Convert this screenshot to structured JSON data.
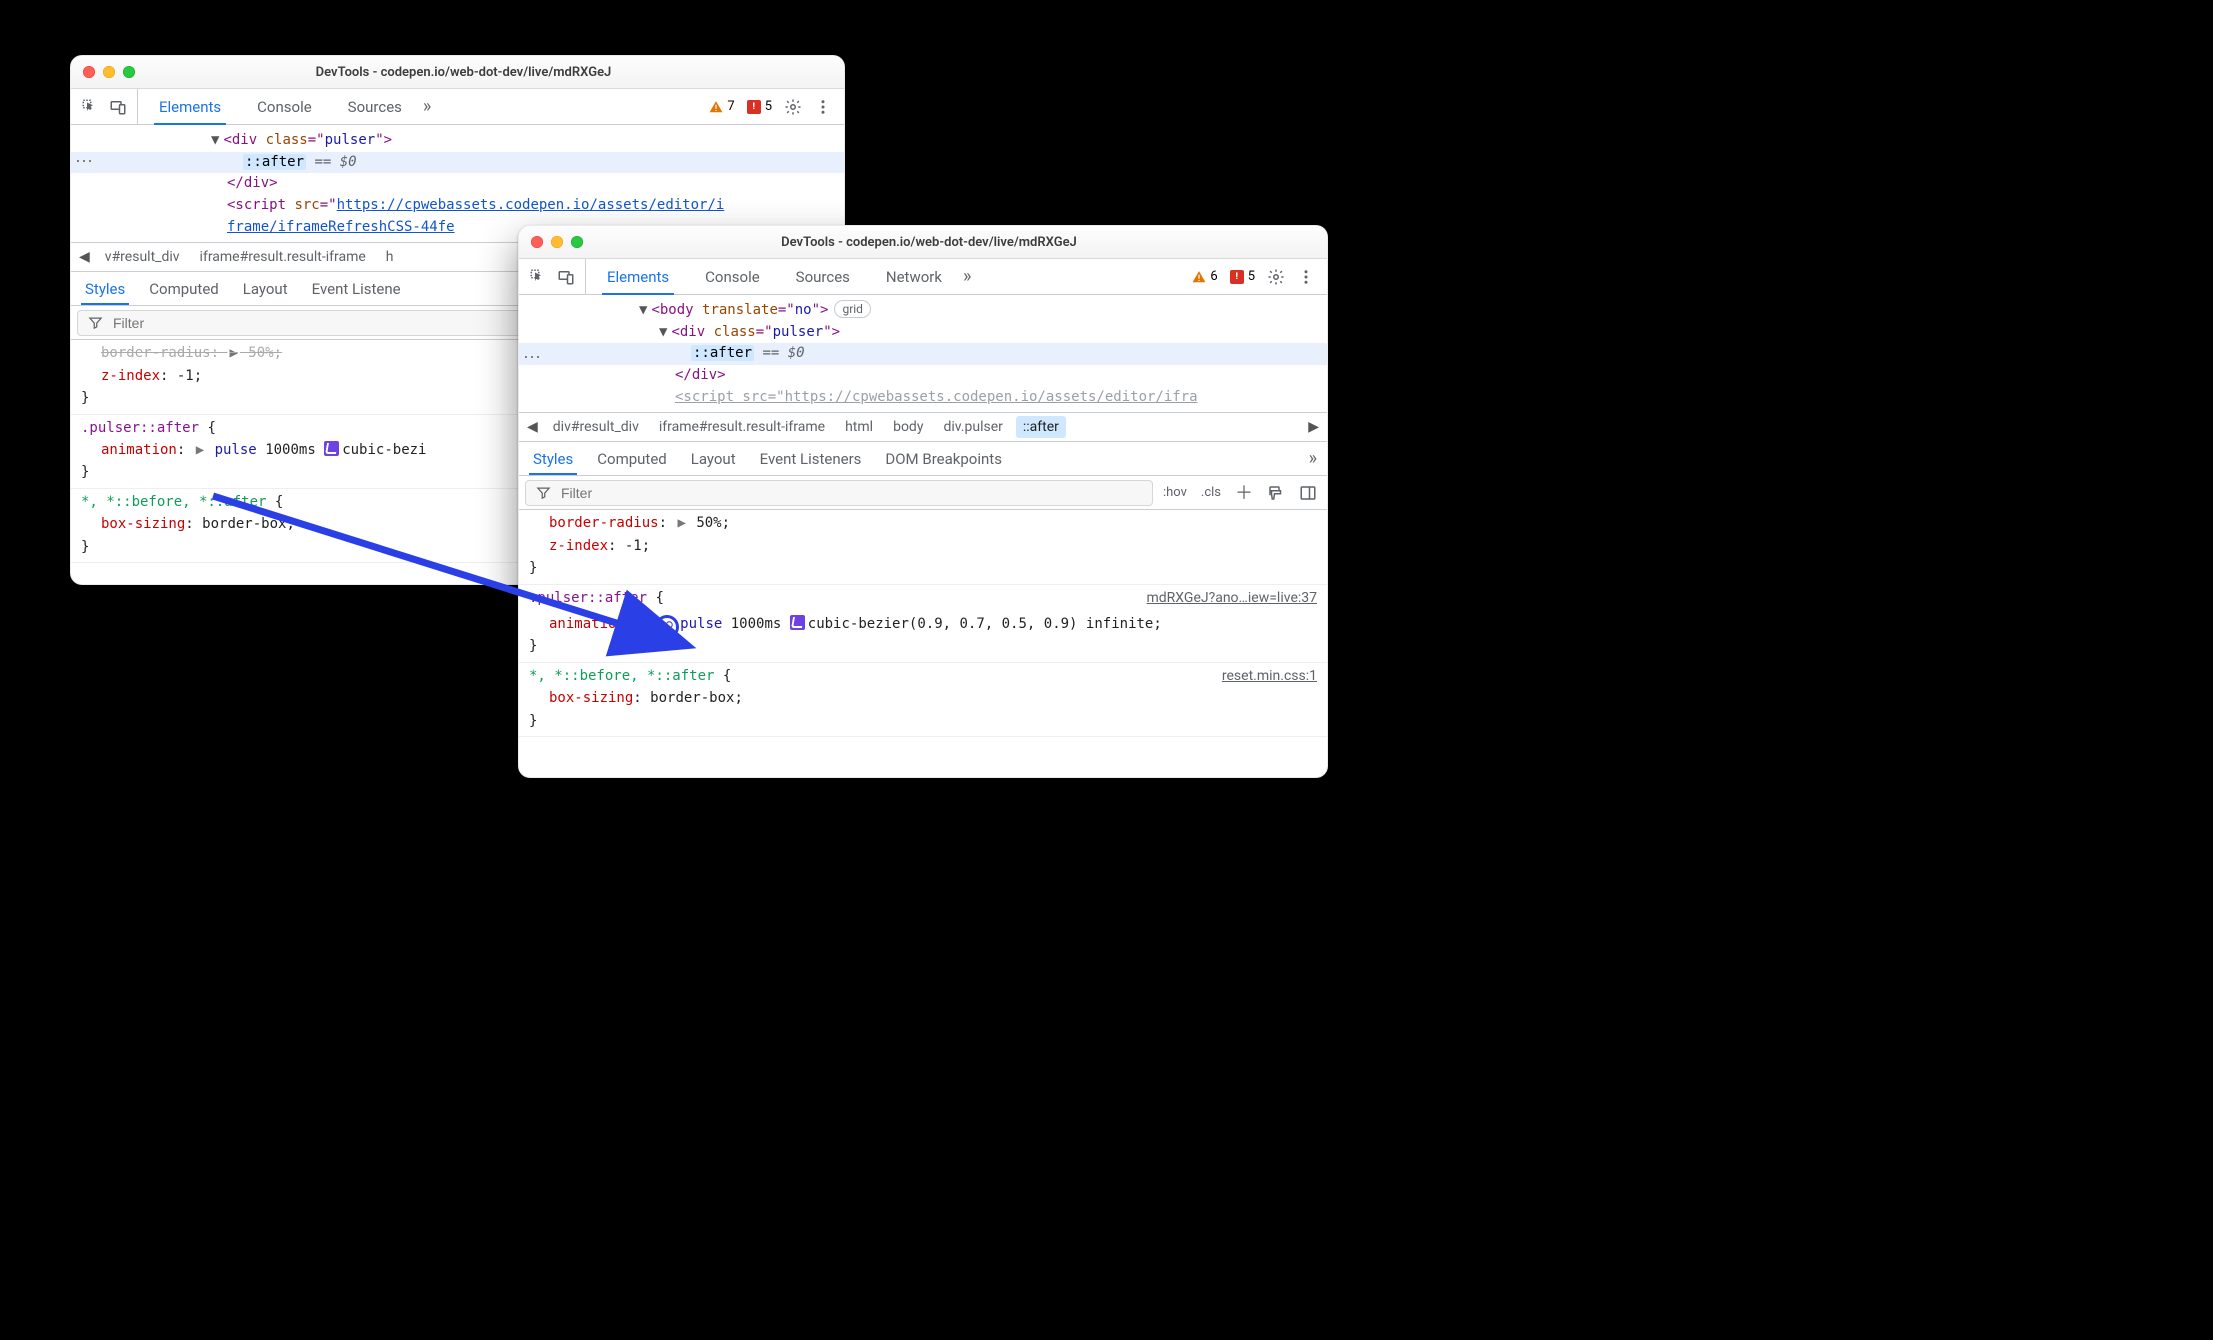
{
  "win1": {
    "title": "DevTools - codepen.io/web-dot-dev/live/mdRXGeJ",
    "tabs": {
      "elements": "Elements",
      "console": "Console",
      "sources": "Sources"
    },
    "warn_count": "7",
    "err_count": "5",
    "dom": {
      "div_open": "<div class=\"pulser\">",
      "after": "::after",
      "eq": "== $0",
      "div_close": "</div>",
      "script_open_a": "<script src=\"",
      "script_href1": "https://cpwebassets.codepen.io/assets/editor/i",
      "script_href2": "frame/iframeRefreshCSS-44fe"
    },
    "crumbs": {
      "a": "v#result_div",
      "b": "iframe#result.result-iframe",
      "c": "h"
    },
    "subtabs": {
      "styles": "Styles",
      "computed": "Computed",
      "layout": "Layout",
      "ev": "Event Listene"
    },
    "filter_placeholder": "Filter",
    "styles": {
      "fragA_prop": "border-radius",
      "fragA_tri": "▶",
      "fragA_val": "50%",
      "z_prop": "z-index",
      "z_val": "-1",
      "rule2_sel": ".pulser::after",
      "r2_prop": "animation",
      "r2_tri": "▶",
      "r2_name": "pulse",
      "r2_dur": "1000ms",
      "r2_cb": "cubic-bezi",
      "rule3_sel": "*, *::before, *::after",
      "r3_prop": "box-sizing",
      "r3_val": "border-box"
    }
  },
  "win2": {
    "title": "DevTools - codepen.io/web-dot-dev/live/mdRXGeJ",
    "tabs": {
      "elements": "Elements",
      "console": "Console",
      "sources": "Sources",
      "network": "Network"
    },
    "warn_count": "6",
    "err_count": "5",
    "dom": {
      "body_open": "<body translate=\"no\">",
      "body_badge": "grid",
      "div_open": "<div class=\"pulser\">",
      "after": "::after",
      "eq": "== $0",
      "div_close": "</div>",
      "script_cut": "<script src=\"https://cpwebassets.codepen.io/assets/editor/ifra"
    },
    "crumbs": {
      "a": "div#result_div",
      "b": "iframe#result.result-iframe",
      "c": "html",
      "d": "body",
      "e": "div.pulser",
      "f": "::after"
    },
    "subtabs": {
      "styles": "Styles",
      "computed": "Computed",
      "layout": "Layout",
      "ev": "Event Listeners",
      "dom": "DOM Breakpoints"
    },
    "filter_placeholder": "Filter",
    "hov": ":hov",
    "cls": ".cls",
    "styles": {
      "r1_p1": "border-radius",
      "r1_tri": "▶",
      "r1_v1": "50%",
      "r1_p2": "z-index",
      "r1_v2": "-1",
      "r2_sel": ".pulser::after",
      "r2_src": "mdRXGeJ?ano…iew=live:37",
      "r2_prop": "animation",
      "r2_tri": "▶",
      "r2_name": "pulse",
      "r2_dur": "1000ms",
      "r2_cb": "cubic-bezier(0.9, 0.7, 0.5, 0.9)",
      "r2_inf": "infinite",
      "r3_sel": "*, *::before, *::after",
      "r3_src": "reset.min.css:1",
      "r3_prop": "box-sizing",
      "r3_val": "border-box"
    }
  }
}
